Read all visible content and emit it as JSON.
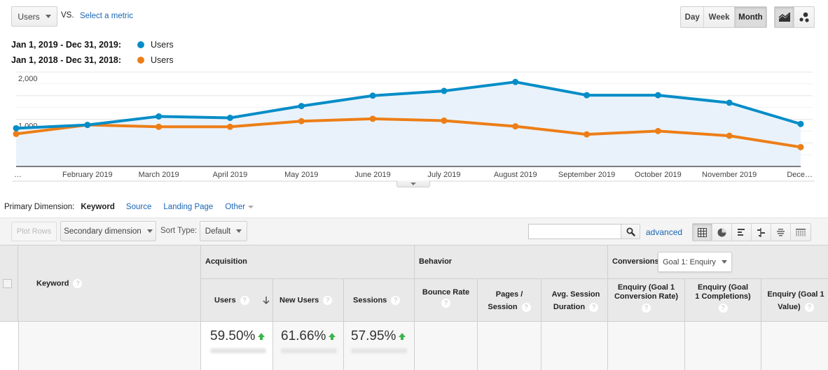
{
  "toolbar": {
    "metric_select": "Users",
    "vs_label": "VS.",
    "select_metric_link": "Select a metric",
    "period_buttons": [
      {
        "label": "Day",
        "active": false
      },
      {
        "label": "Week",
        "active": false
      },
      {
        "label": "Month",
        "active": true
      }
    ],
    "chart_type_buttons": [
      {
        "icon": "line-chart-icon",
        "active": true
      },
      {
        "icon": "motion-chart-icon",
        "active": false
      }
    ]
  },
  "legend": [
    {
      "date_range": "Jan 1, 2019 - Dec 31, 2019:",
      "metric": "Users",
      "color": "#058dc7"
    },
    {
      "date_range": "Jan 1, 2018 - Dec 31, 2018:",
      "metric": "Users",
      "color": "#ed7e17"
    }
  ],
  "chart_data": {
    "type": "line",
    "title": "",
    "xlabel": "",
    "ylabel": "",
    "x": [
      "…",
      "February 2019",
      "March 2019",
      "April 2019",
      "May 2019",
      "June 2019",
      "July 2019",
      "August 2019",
      "September 2019",
      "October 2019",
      "November 2019",
      "Dece…"
    ],
    "yticks": [
      "2,000",
      "1,000"
    ],
    "ylim": [
      0,
      2000
    ],
    "grid": true,
    "legend_position": "top-left",
    "series": [
      {
        "name": "Users (Jan 1, 2019 - Dec 31, 2019)",
        "color": "#058dc7",
        "filled": true,
        "values": [
          810,
          880,
          1060,
          1030,
          1280,
          1500,
          1600,
          1790,
          1510,
          1510,
          1350,
          900
        ]
      },
      {
        "name": "Users (Jan 1, 2018 - Dec 31, 2018)",
        "color": "#ed7e17",
        "filled": false,
        "values": [
          690,
          880,
          840,
          840,
          960,
          1010,
          970,
          850,
          680,
          750,
          650,
          410
        ]
      }
    ]
  },
  "dimension_bar": {
    "label": "Primary Dimension:",
    "active": "Keyword",
    "links": [
      "Source",
      "Landing Page",
      "Other"
    ]
  },
  "table_toolbar": {
    "plot_rows": "Plot Rows",
    "secondary_dimension": "Secondary dimension",
    "sort_type_label": "Sort Type:",
    "sort_type_value": "Default",
    "search_placeholder": "",
    "advanced_link": "advanced",
    "view_buttons": [
      {
        "icon": "table-view-icon",
        "active": true
      },
      {
        "icon": "pie-view-icon",
        "active": false
      },
      {
        "icon": "performance-view-icon",
        "active": false
      },
      {
        "icon": "comparison-view-icon",
        "active": false
      },
      {
        "icon": "term-cloud-view-icon",
        "active": false
      },
      {
        "icon": "pivot-view-icon",
        "active": false
      }
    ]
  },
  "table": {
    "keyword_header": "Keyword",
    "groups": {
      "acquisition": "Acquisition",
      "behavior": "Behavior",
      "conversions": "Conversions",
      "goal_select": "Goal 1: Enquiry"
    },
    "columns": [
      {
        "key": "users",
        "label": "Users",
        "sorted": true
      },
      {
        "key": "new_users",
        "label": "New Users"
      },
      {
        "key": "sessions",
        "label": "Sessions"
      },
      {
        "key": "bounce_rate",
        "label": "Bounce Rate"
      },
      {
        "key": "pages_session",
        "label": "Pages / Session"
      },
      {
        "key": "avg_session_duration",
        "label": "Avg. Session Duration"
      },
      {
        "key": "goal_conv_rate",
        "label": "Enquiry (Goal 1 Conversion Rate)"
      },
      {
        "key": "goal_completions",
        "label": "Enquiry (Goal 1 Completions)"
      },
      {
        "key": "goal_value",
        "label": "Enquiry (Goal 1 Value)"
      }
    ],
    "summary_row": {
      "users_change": "59.50%",
      "new_users_change": "61.66%",
      "sessions_change": "57.95%",
      "direction": "up"
    }
  }
}
